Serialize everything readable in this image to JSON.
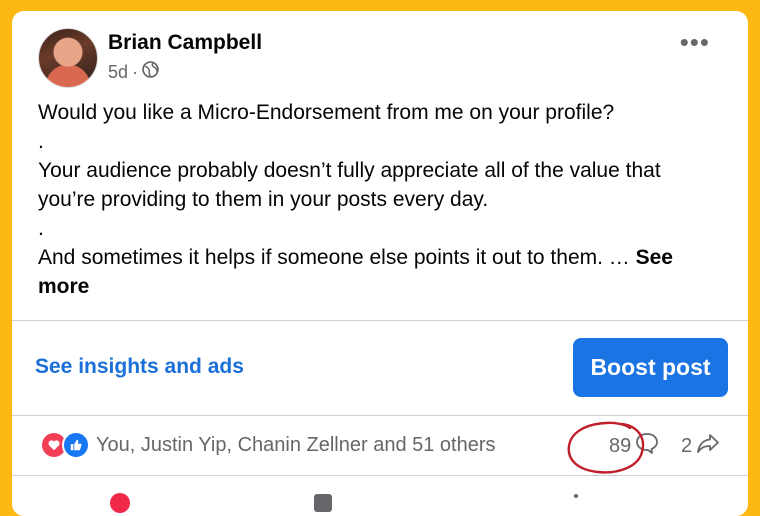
{
  "post": {
    "author": "Brian Campbell",
    "time": "5d",
    "separator": "·",
    "paragraphs": [
      "Would you like a Micro-Endorsement from me on your profile?",
      ".",
      "Your audience probably doesn’t fully appreciate all of the value that you’re providing to them in your posts every day.",
      ".",
      "And sometimes it helps if someone else points it out to them. … "
    ],
    "see_more": "See more"
  },
  "insights_link": "See insights and ads",
  "boost_button": "Boost post",
  "engagement": {
    "reactions_text": "You, Justin Yip, Chanin Zellner and 51 others",
    "comments": "89",
    "shares": "2"
  },
  "colors": {
    "background": "#FDB813",
    "accent": "#1a74e4",
    "link": "#1a6fd8",
    "annotation": "#c0202a"
  },
  "icons": [
    "globe-icon",
    "more-icon",
    "love-reaction-icon",
    "like-reaction-icon",
    "comment-icon",
    "share-icon"
  ]
}
